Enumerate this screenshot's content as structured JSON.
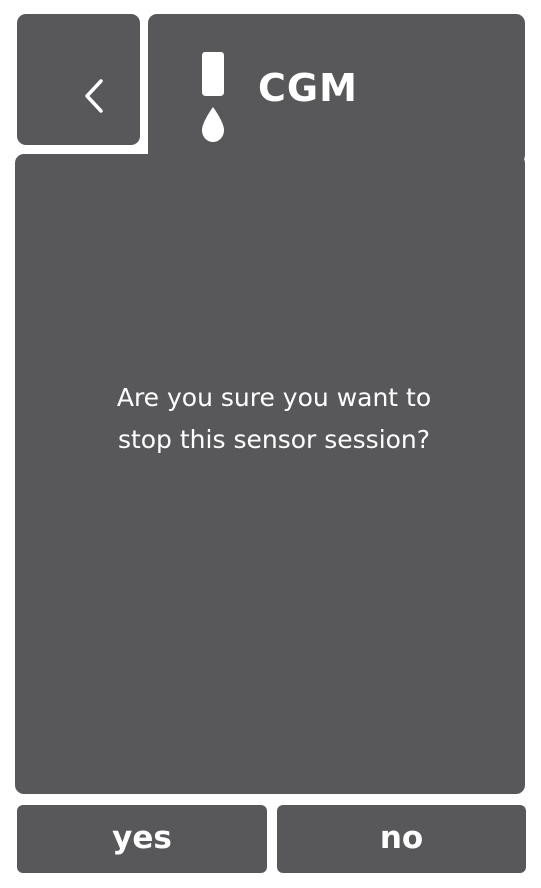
{
  "header": {
    "title": "CGM",
    "icon": "cgm-sensor-drop-icon",
    "back_icon": "chevron-left-icon"
  },
  "dialog": {
    "message_line1": "Are you sure you want to",
    "message_line2": "stop this sensor session?"
  },
  "actions": {
    "yes_label": "yes",
    "no_label": "no"
  },
  "colors": {
    "panel": "#58585a",
    "background": "#ffffff",
    "text": "#ffffff"
  }
}
